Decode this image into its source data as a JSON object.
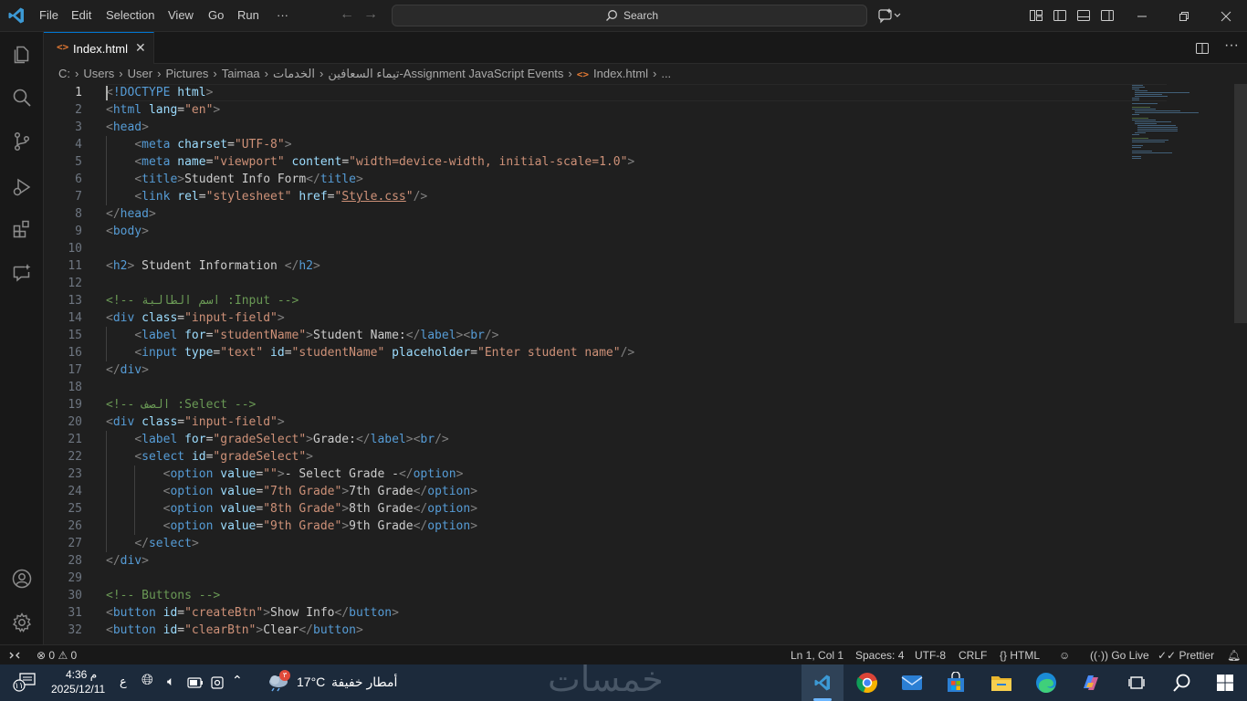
{
  "titlebar": {
    "menu": [
      "File",
      "Edit",
      "Selection",
      "View",
      "Go",
      "Run",
      "···"
    ],
    "search_label": "Search"
  },
  "tab": {
    "label": "Index.html",
    "icon_glyph": "<>",
    "close_glyph": "✕"
  },
  "breadcrumb": {
    "parts": [
      "C:",
      "Users",
      "User",
      "Pictures",
      "Taimaa",
      "الخدمات",
      "تيماء السعافين-Assignment JavaScript Events",
      "Index.html",
      "..."
    ]
  },
  "editor": {
    "active_line": 1,
    "lines": [
      [
        [
          "t-br",
          "<"
        ],
        [
          "t-tag",
          "!DOCTYPE"
        ],
        [
          "t-txt",
          " "
        ],
        [
          "t-attr",
          "html"
        ],
        [
          "t-br",
          ">"
        ]
      ],
      [
        [
          "t-br",
          "<"
        ],
        [
          "t-tag",
          "html"
        ],
        [
          "t-txt",
          " "
        ],
        [
          "t-attr",
          "lang"
        ],
        [
          "t-eq",
          "="
        ],
        [
          "t-str",
          "\"en\""
        ],
        [
          "t-br",
          ">"
        ]
      ],
      [
        [
          "t-br",
          "<"
        ],
        [
          "t-tag",
          "head"
        ],
        [
          "t-br",
          ">"
        ]
      ],
      [
        [
          "t-txt",
          "    "
        ],
        [
          "t-br",
          "<"
        ],
        [
          "t-tag",
          "meta"
        ],
        [
          "t-txt",
          " "
        ],
        [
          "t-attr",
          "charset"
        ],
        [
          "t-eq",
          "="
        ],
        [
          "t-str",
          "\"UTF-8\""
        ],
        [
          "t-br",
          ">"
        ]
      ],
      [
        [
          "t-txt",
          "    "
        ],
        [
          "t-br",
          "<"
        ],
        [
          "t-tag",
          "meta"
        ],
        [
          "t-txt",
          " "
        ],
        [
          "t-attr",
          "name"
        ],
        [
          "t-eq",
          "="
        ],
        [
          "t-str",
          "\"viewport\""
        ],
        [
          "t-txt",
          " "
        ],
        [
          "t-attr",
          "content"
        ],
        [
          "t-eq",
          "="
        ],
        [
          "t-str",
          "\"width=device-width, initial-scale=1.0\""
        ],
        [
          "t-br",
          ">"
        ]
      ],
      [
        [
          "t-txt",
          "    "
        ],
        [
          "t-br",
          "<"
        ],
        [
          "t-tag",
          "title"
        ],
        [
          "t-br",
          ">"
        ],
        [
          "t-txt",
          "Student Info Form"
        ],
        [
          "t-br",
          "</"
        ],
        [
          "t-tag",
          "title"
        ],
        [
          "t-br",
          ">"
        ]
      ],
      [
        [
          "t-txt",
          "    "
        ],
        [
          "t-br",
          "<"
        ],
        [
          "t-tag",
          "link"
        ],
        [
          "t-txt",
          " "
        ],
        [
          "t-attr",
          "rel"
        ],
        [
          "t-eq",
          "="
        ],
        [
          "t-str",
          "\"stylesheet\""
        ],
        [
          "t-txt",
          " "
        ],
        [
          "t-attr",
          "href"
        ],
        [
          "t-eq",
          "="
        ],
        [
          "t-str",
          "\""
        ],
        [
          "t-str t-u",
          "Style.css"
        ],
        [
          "t-str",
          "\""
        ],
        [
          "t-br",
          "/>"
        ]
      ],
      [
        [
          "t-br",
          "</"
        ],
        [
          "t-tag",
          "head"
        ],
        [
          "t-br",
          ">"
        ]
      ],
      [
        [
          "t-br",
          "<"
        ],
        [
          "t-tag",
          "body"
        ],
        [
          "t-br",
          ">"
        ]
      ],
      [],
      [
        [
          "t-br",
          "<"
        ],
        [
          "t-tag",
          "h2"
        ],
        [
          "t-br",
          ">"
        ],
        [
          "t-txt",
          " Student Information "
        ],
        [
          "t-br",
          "</"
        ],
        [
          "t-tag",
          "h2"
        ],
        [
          "t-br",
          ">"
        ]
      ],
      [],
      [
        [
          "t-com",
          "<!-- اسم الطالبة :Input -->"
        ]
      ],
      [
        [
          "t-br",
          "<"
        ],
        [
          "t-tag",
          "div"
        ],
        [
          "t-txt",
          " "
        ],
        [
          "t-attr",
          "class"
        ],
        [
          "t-eq",
          "="
        ],
        [
          "t-str",
          "\"input-field\""
        ],
        [
          "t-br",
          ">"
        ]
      ],
      [
        [
          "t-txt",
          "    "
        ],
        [
          "t-br",
          "<"
        ],
        [
          "t-tag",
          "label"
        ],
        [
          "t-txt",
          " "
        ],
        [
          "t-attr",
          "for"
        ],
        [
          "t-eq",
          "="
        ],
        [
          "t-str",
          "\"studentName\""
        ],
        [
          "t-br",
          ">"
        ],
        [
          "t-txt",
          "Student Name:"
        ],
        [
          "t-br",
          "</"
        ],
        [
          "t-tag",
          "label"
        ],
        [
          "t-br",
          "><"
        ],
        [
          "t-tag",
          "br"
        ],
        [
          "t-br",
          "/>"
        ]
      ],
      [
        [
          "t-txt",
          "    "
        ],
        [
          "t-br",
          "<"
        ],
        [
          "t-tag",
          "input"
        ],
        [
          "t-txt",
          " "
        ],
        [
          "t-attr",
          "type"
        ],
        [
          "t-eq",
          "="
        ],
        [
          "t-str",
          "\"text\""
        ],
        [
          "t-txt",
          " "
        ],
        [
          "t-attr",
          "id"
        ],
        [
          "t-eq",
          "="
        ],
        [
          "t-str",
          "\"studentName\""
        ],
        [
          "t-txt",
          " "
        ],
        [
          "t-attr",
          "placeholder"
        ],
        [
          "t-eq",
          "="
        ],
        [
          "t-str",
          "\"Enter student name\""
        ],
        [
          "t-br",
          "/>"
        ]
      ],
      [
        [
          "t-br",
          "</"
        ],
        [
          "t-tag",
          "div"
        ],
        [
          "t-br",
          ">"
        ]
      ],
      [],
      [
        [
          "t-com",
          "<!-- الصف :Select -->"
        ]
      ],
      [
        [
          "t-br",
          "<"
        ],
        [
          "t-tag",
          "div"
        ],
        [
          "t-txt",
          " "
        ],
        [
          "t-attr",
          "class"
        ],
        [
          "t-eq",
          "="
        ],
        [
          "t-str",
          "\"input-field\""
        ],
        [
          "t-br",
          ">"
        ]
      ],
      [
        [
          "t-txt",
          "    "
        ],
        [
          "t-br",
          "<"
        ],
        [
          "t-tag",
          "label"
        ],
        [
          "t-txt",
          " "
        ],
        [
          "t-attr",
          "for"
        ],
        [
          "t-eq",
          "="
        ],
        [
          "t-str",
          "\"gradeSelect\""
        ],
        [
          "t-br",
          ">"
        ],
        [
          "t-txt",
          "Grade:"
        ],
        [
          "t-br",
          "</"
        ],
        [
          "t-tag",
          "label"
        ],
        [
          "t-br",
          "><"
        ],
        [
          "t-tag",
          "br"
        ],
        [
          "t-br",
          "/>"
        ]
      ],
      [
        [
          "t-txt",
          "    "
        ],
        [
          "t-br",
          "<"
        ],
        [
          "t-tag",
          "select"
        ],
        [
          "t-txt",
          " "
        ],
        [
          "t-attr",
          "id"
        ],
        [
          "t-eq",
          "="
        ],
        [
          "t-str",
          "\"gradeSelect\""
        ],
        [
          "t-br",
          ">"
        ]
      ],
      [
        [
          "t-txt",
          "        "
        ],
        [
          "t-br",
          "<"
        ],
        [
          "t-tag",
          "option"
        ],
        [
          "t-txt",
          " "
        ],
        [
          "t-attr",
          "value"
        ],
        [
          "t-eq",
          "="
        ],
        [
          "t-str",
          "\"\""
        ],
        [
          "t-br",
          ">"
        ],
        [
          "t-txt",
          "- Select Grade -"
        ],
        [
          "t-br",
          "</"
        ],
        [
          "t-tag",
          "option"
        ],
        [
          "t-br",
          ">"
        ]
      ],
      [
        [
          "t-txt",
          "        "
        ],
        [
          "t-br",
          "<"
        ],
        [
          "t-tag",
          "option"
        ],
        [
          "t-txt",
          " "
        ],
        [
          "t-attr",
          "value"
        ],
        [
          "t-eq",
          "="
        ],
        [
          "t-str",
          "\"7th Grade\""
        ],
        [
          "t-br",
          ">"
        ],
        [
          "t-txt",
          "7th Grade"
        ],
        [
          "t-br",
          "</"
        ],
        [
          "t-tag",
          "option"
        ],
        [
          "t-br",
          ">"
        ]
      ],
      [
        [
          "t-txt",
          "        "
        ],
        [
          "t-br",
          "<"
        ],
        [
          "t-tag",
          "option"
        ],
        [
          "t-txt",
          " "
        ],
        [
          "t-attr",
          "value"
        ],
        [
          "t-eq",
          "="
        ],
        [
          "t-str",
          "\"8th Grade\""
        ],
        [
          "t-br",
          ">"
        ],
        [
          "t-txt",
          "8th Grade"
        ],
        [
          "t-br",
          "</"
        ],
        [
          "t-tag",
          "option"
        ],
        [
          "t-br",
          ">"
        ]
      ],
      [
        [
          "t-txt",
          "        "
        ],
        [
          "t-br",
          "<"
        ],
        [
          "t-tag",
          "option"
        ],
        [
          "t-txt",
          " "
        ],
        [
          "t-attr",
          "value"
        ],
        [
          "t-eq",
          "="
        ],
        [
          "t-str",
          "\"9th Grade\""
        ],
        [
          "t-br",
          ">"
        ],
        [
          "t-txt",
          "9th Grade"
        ],
        [
          "t-br",
          "</"
        ],
        [
          "t-tag",
          "option"
        ],
        [
          "t-br",
          ">"
        ]
      ],
      [
        [
          "t-txt",
          "    "
        ],
        [
          "t-br",
          "</"
        ],
        [
          "t-tag",
          "select"
        ],
        [
          "t-br",
          ">"
        ]
      ],
      [
        [
          "t-br",
          "</"
        ],
        [
          "t-tag",
          "div"
        ],
        [
          "t-br",
          ">"
        ]
      ],
      [],
      [
        [
          "t-com",
          "<!-- Buttons -->"
        ]
      ],
      [
        [
          "t-br",
          "<"
        ],
        [
          "t-tag",
          "button"
        ],
        [
          "t-txt",
          " "
        ],
        [
          "t-attr",
          "id"
        ],
        [
          "t-eq",
          "="
        ],
        [
          "t-str",
          "\"createBtn\""
        ],
        [
          "t-br",
          ">"
        ],
        [
          "t-txt",
          "Show Info"
        ],
        [
          "t-br",
          "</"
        ],
        [
          "t-tag",
          "button"
        ],
        [
          "t-br",
          ">"
        ]
      ],
      [
        [
          "t-br",
          "<"
        ],
        [
          "t-tag",
          "button"
        ],
        [
          "t-txt",
          " "
        ],
        [
          "t-attr",
          "id"
        ],
        [
          "t-eq",
          "="
        ],
        [
          "t-str",
          "\"clearBtn\""
        ],
        [
          "t-br",
          ">"
        ],
        [
          "t-txt",
          "Clear"
        ],
        [
          "t-br",
          "</"
        ],
        [
          "t-tag",
          "button"
        ],
        [
          "t-br",
          ">"
        ]
      ]
    ]
  },
  "statusbar": {
    "errors": "0",
    "warnings": "0",
    "position": "Ln 1, Col 1",
    "spaces": "Spaces: 4",
    "encoding": "UTF-8",
    "eol": "CRLF",
    "language": "HTML",
    "go_live": "Go Live",
    "prettier": "Prettier"
  },
  "taskbar": {
    "time": "4:36 م",
    "date": "2025/12/11",
    "lang_indicator": "ع",
    "weather_temp": "17°C",
    "weather_desc": "أمطار خفيفة",
    "notification_count": "١١",
    "weather_badge": "٣",
    "watermark": "خمسات"
  },
  "colors": {
    "accent": "#0078d4",
    "editor_bg": "#1f1f1f",
    "taskbar_bg": "#1c2a3b"
  }
}
